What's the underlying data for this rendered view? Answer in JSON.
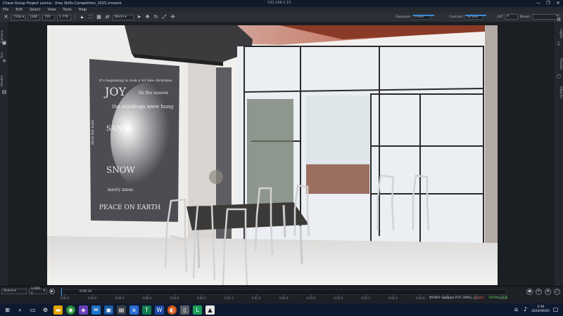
{
  "window": {
    "title": "Chaos Group Project Lavina - Vray Skills Competition_2015.vrscene",
    "host": "192.168.2.15",
    "minimize": "—",
    "maximize": "❐",
    "close": "✕"
  },
  "menu": [
    "File",
    "Edit",
    "Select",
    "View",
    "Tools",
    "Help"
  ],
  "toolbar": {
    "resolution": "720p",
    "width": "1280",
    "height": "720",
    "ratio": "1.778",
    "mode": "World",
    "exposure_label": "Exposure",
    "exposure_value": "0.000",
    "contrast_label": "Contrast",
    "contrast_value": "50.000",
    "lut_label": "LUT",
    "bloom_label": "Bloom",
    "bloom_value": ""
  },
  "left_panel": {
    "tabs": [
      "Camera",
      "Sun",
      "Render"
    ]
  },
  "right_panel": {
    "tabs": [
      "Lights",
      "Presets",
      "Objects"
    ]
  },
  "timeline": {
    "scene_select": "Scene",
    "speed_select": "1.000 x",
    "current_time": "0:00:10",
    "ticks": [
      "0:00.0",
      "0:00.2",
      "0:00.4",
      "0:00.6",
      "0:00.8",
      "0:01.0",
      "0:01.2",
      "0:01.4",
      "0:01.6",
      "0:01.8",
      "0:02.0",
      "0:02.2",
      "0:02.4",
      "0:02.6",
      "0:02.8",
      "0:03.0",
      "0:03.2"
    ],
    "gpu": "NVIDIA GeForce RTX 3080",
    "fps": "13 fps",
    "vram": "VRAM: 1 GB"
  },
  "taskbar": {
    "time": "3:39",
    "date": "2020/06/05"
  },
  "colors": {
    "accent": "#3a8dd8",
    "taskbar": "#0e1a30",
    "fps_red": "#e25b4f",
    "vram_green": "#58c24d"
  }
}
